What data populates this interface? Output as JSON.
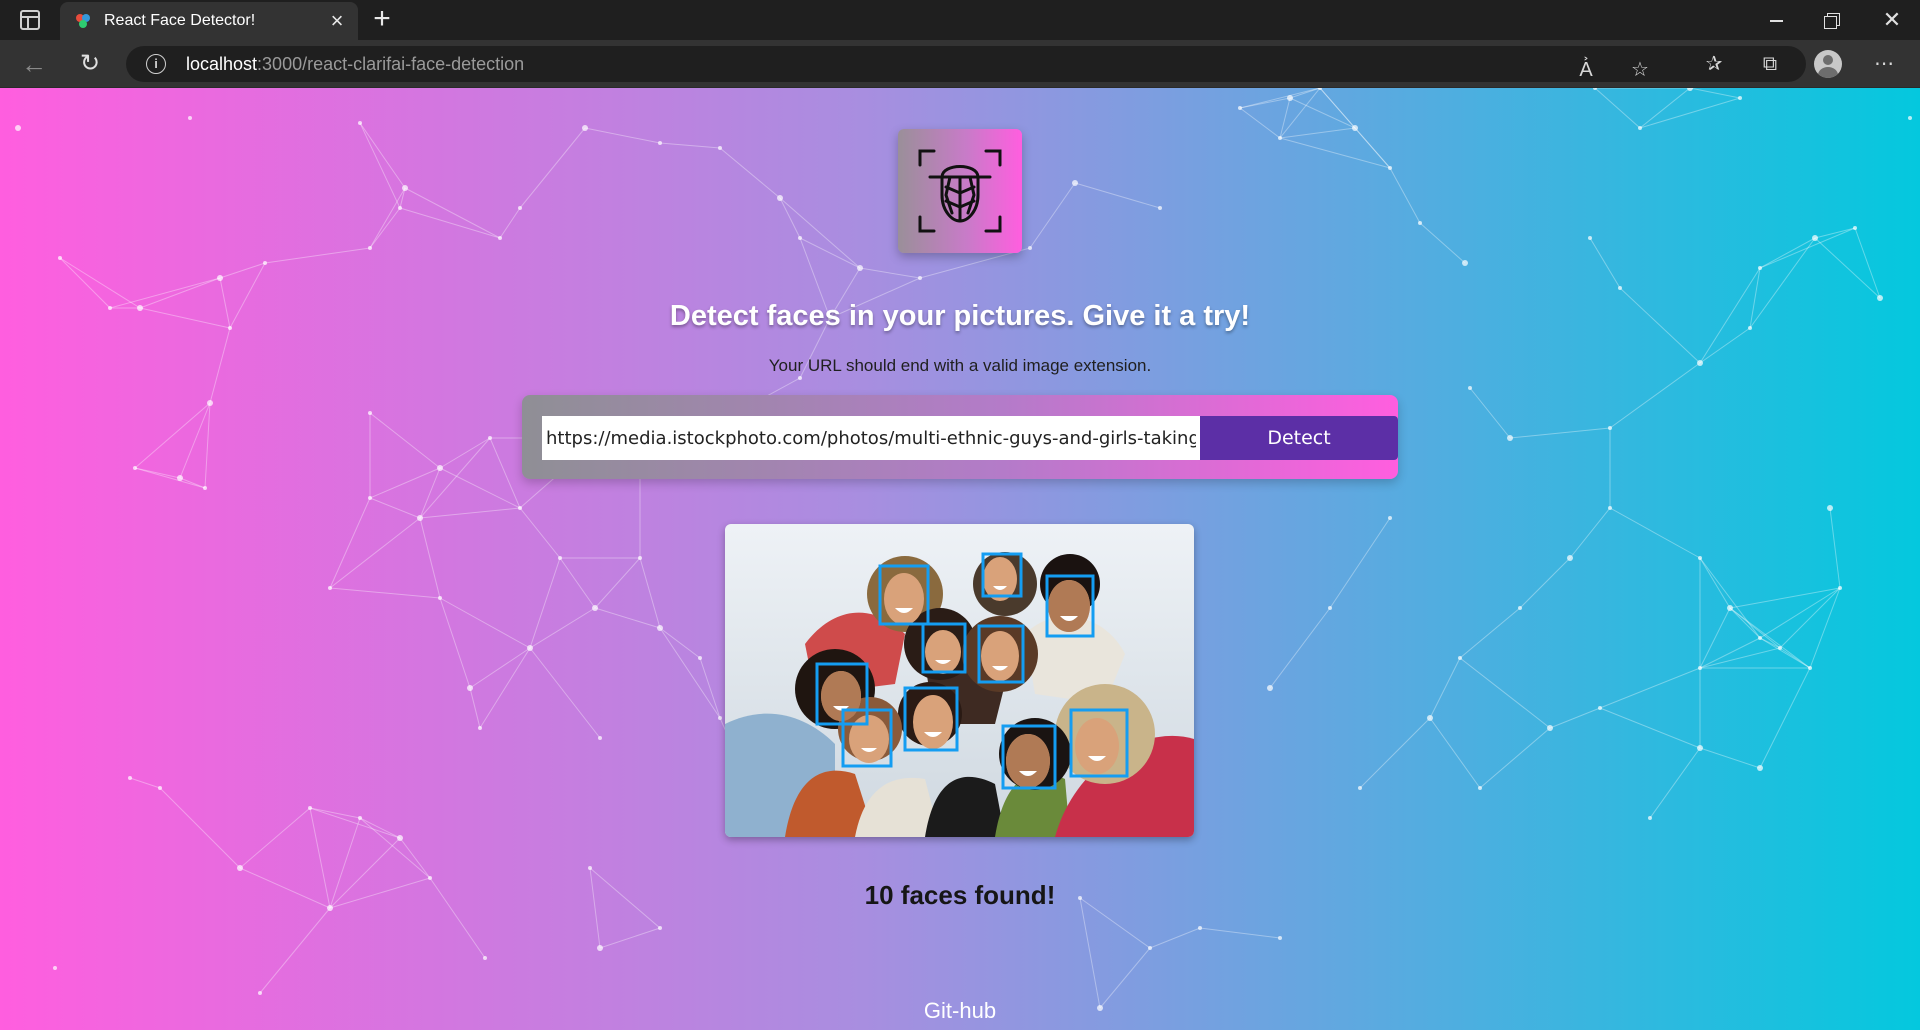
{
  "browser": {
    "tab_title": "React Face Detector!",
    "url_host": "localhost",
    "url_path": ":3000/react-clarifai-face-detection",
    "toolbar_icons": [
      "read-aloud-icon",
      "add-favorite-icon",
      "favorites-icon",
      "collections-icon",
      "profile-avatar",
      "more-menu-icon"
    ]
  },
  "page": {
    "headline": "Detect faces in your pictures. Give it a try!",
    "subtext": "Your URL should end with a valid image extension.",
    "input_value": "https://media.istockphoto.com/photos/multi-ethnic-guys-and-girls-taking-selfie",
    "detect_button": "Detect",
    "faces_found": "10 faces found!",
    "footer_link": "Git-hub"
  },
  "colors": {
    "gradient_left": "#ff5edf",
    "gradient_right": "#04c8de",
    "button_bg": "#5c2fa6",
    "face_box": "#149df2"
  },
  "detection": {
    "faces_count": 10
  }
}
